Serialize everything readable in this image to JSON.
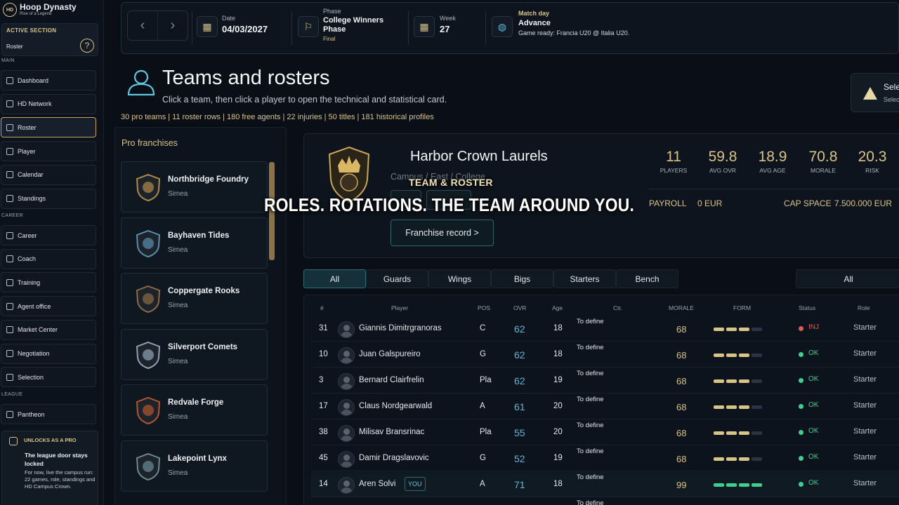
{
  "brand": {
    "logo": "HD",
    "title": "Hoop Dynasty",
    "subtitle": "Rise of a Legend"
  },
  "active_section": {
    "label": "ACTIVE SECTION",
    "value": "Roster"
  },
  "sidebar": {
    "main_label": "MAIN",
    "main": [
      {
        "label": "Dashboard"
      },
      {
        "label": "HD Network"
      },
      {
        "label": "Roster",
        "active": true
      },
      {
        "label": "Player"
      },
      {
        "label": "Calendar"
      },
      {
        "label": "Standings"
      }
    ],
    "career_label": "CAREER",
    "career": [
      {
        "label": "Career"
      },
      {
        "label": "Coach"
      },
      {
        "label": "Training"
      },
      {
        "label": "Agent office"
      },
      {
        "label": "Market Center"
      },
      {
        "label": "Negotiation"
      },
      {
        "label": "Selection"
      }
    ],
    "league_label": "LEAGUE",
    "league": [
      {
        "label": "Pantheon"
      }
    ]
  },
  "unlock": {
    "head": "UNLOCKS AS A PRO",
    "title": "The league door stays locked",
    "text": "For now, live the campus run: 22 games, role, standings and HD Campus Crown."
  },
  "topbar": {
    "date_label": "Date",
    "date_value": "04/03/2027",
    "phase_label": "Phase",
    "phase_value": "College Winners Phase",
    "phase_note": "Final",
    "week_label": "Week",
    "week_value": "27",
    "match_label": "Match day",
    "match_value": "Advance",
    "match_desc": "Game ready: Francia U20 @ Italia U20."
  },
  "header": {
    "title": "Teams and rosters",
    "subtitle": "Click a team, then click a player to open the technical and statistical card.",
    "stats": "30 pro teams | 11 roster rows | 180 free agents | 22 injuries | 50 titles | 181 historical profiles",
    "warn_title": "Sele",
    "warn_sub": "Selec"
  },
  "franchises": {
    "heading": "Pro franchises",
    "items": [
      {
        "name": "Northbridge Foundry",
        "region": "Simea",
        "color": "#b08a4a"
      },
      {
        "name": "Bayhaven Tides",
        "region": "Simea",
        "color": "#5a8fb0"
      },
      {
        "name": "Coppergate Rooks",
        "region": "Simea",
        "color": "#8c6a46"
      },
      {
        "name": "Silverport Comets",
        "region": "Simea",
        "color": "#8fa2b6"
      },
      {
        "name": "Redvale Forge",
        "region": "Simea",
        "color": "#b3562f"
      },
      {
        "name": "Lakepoint Lynx",
        "region": "Simea",
        "color": "#6b8a96"
      }
    ]
  },
  "team": {
    "name": "Harbor Crown Laurels",
    "location": "Campus / East / College",
    "record_button": "Franchise record >",
    "stats": [
      {
        "value": "11",
        "label": "PLAYERS"
      },
      {
        "value": "59.8",
        "label": "AVG OVR"
      },
      {
        "value": "18.9",
        "label": "AVG AGE"
      },
      {
        "value": "70.8",
        "label": "MORALE"
      },
      {
        "value": "20.3",
        "label": "RISK"
      }
    ],
    "payroll_label": "PAYROLL",
    "payroll_value": "0 EUR",
    "cap_label": "CAP SPACE",
    "cap_value": "7.500.000 EUR"
  },
  "caption": {
    "top": "TEAM & ROSTER",
    "main": "ROLES. ROTATIONS. THE TEAM AROUND YOU."
  },
  "tabs": [
    {
      "label": "All",
      "active": true
    },
    {
      "label": "Guards"
    },
    {
      "label": "Wings"
    },
    {
      "label": "Bigs"
    },
    {
      "label": "Starters"
    },
    {
      "label": "Bench"
    }
  ],
  "filter": {
    "value": "All"
  },
  "table": {
    "headers": {
      "num": "#",
      "player": "Player",
      "pos": "POS",
      "ovr": "OVR",
      "age": "Age",
      "ctr": "Ctr.",
      "morale": "MORALE",
      "form": "FORM",
      "status": "Status",
      "role": "Role"
    },
    "rows": [
      {
        "num": "31",
        "name": "Giannis Dimitrgranoras",
        "pos": "C",
        "ovr": "62",
        "age": "18",
        "ctr": "To define",
        "morale": "68",
        "form": 3,
        "status": "INJ",
        "status_color": "#e05a4e",
        "role": "Starter"
      },
      {
        "num": "10",
        "name": "Juan Galspureiro",
        "pos": "G",
        "ovr": "62",
        "age": "18",
        "ctr": "To define",
        "morale": "68",
        "form": 3,
        "status": "OK",
        "status_color": "#3fcf8e",
        "role": "Starter"
      },
      {
        "num": "3",
        "name": "Bernard Clairfrelin",
        "pos": "Pla",
        "ovr": "62",
        "age": "19",
        "ctr": "To define",
        "morale": "68",
        "form": 3,
        "status": "OK",
        "status_color": "#3fcf8e",
        "role": "Starter"
      },
      {
        "num": "17",
        "name": "Claus Nordgearwald",
        "pos": "A",
        "ovr": "61",
        "age": "20",
        "ctr": "To define",
        "morale": "68",
        "form": 3,
        "status": "OK",
        "status_color": "#3fcf8e",
        "role": "Starter"
      },
      {
        "num": "38",
        "name": "Milisav Bransrinac",
        "pos": "Pla",
        "ovr": "55",
        "age": "20",
        "ctr": "To define",
        "morale": "68",
        "form": 3,
        "status": "OK",
        "status_color": "#3fcf8e",
        "role": "Starter"
      },
      {
        "num": "45",
        "name": "Damir Dragslavovic",
        "pos": "G",
        "ovr": "52",
        "age": "19",
        "ctr": "To define",
        "morale": "68",
        "form": 3,
        "status": "OK",
        "status_color": "#3fcf8e",
        "role": "Starter"
      },
      {
        "num": "14",
        "name": "Aren Solvi",
        "you": "YOU",
        "pos": "A",
        "ovr": "71",
        "age": "18",
        "ctr": "To define",
        "morale": "99",
        "form": 4,
        "form_color": "#3fcf8e",
        "status": "OK",
        "status_color": "#3fcf8e",
        "role": "Starter"
      },
      {
        "num": "",
        "name": "",
        "pos": "",
        "ovr": "",
        "age": "",
        "ctr": "To define",
        "morale": "",
        "form": 0,
        "status": "",
        "role": ""
      }
    ]
  }
}
